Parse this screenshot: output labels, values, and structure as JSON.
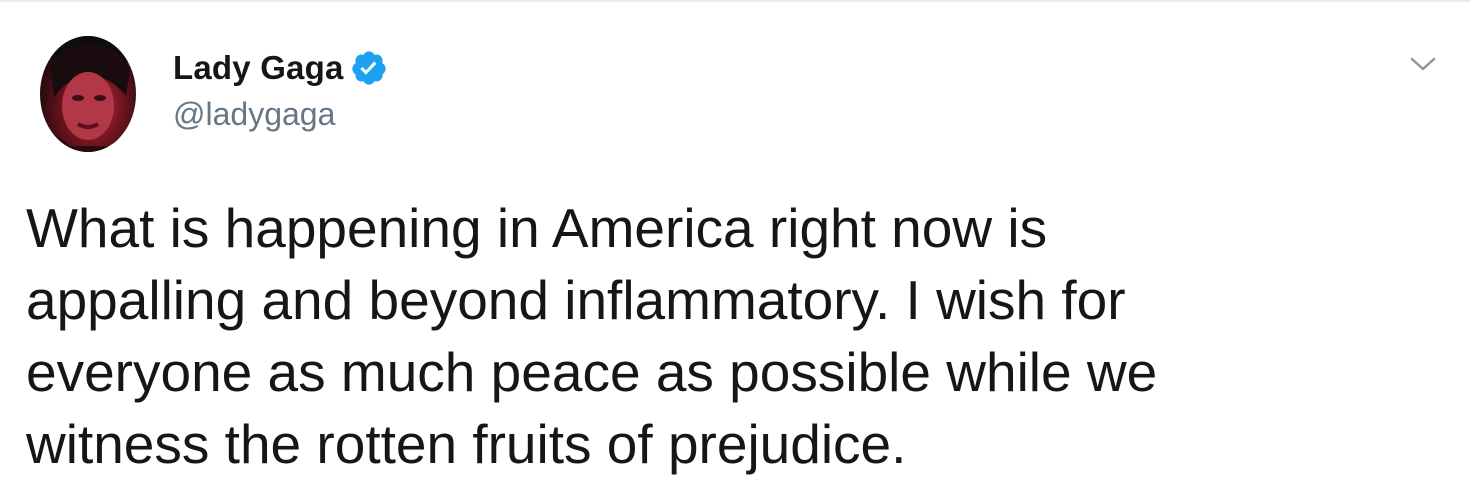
{
  "tweet": {
    "author": {
      "display_name": "Lady Gaga",
      "handle": "@ladygaga",
      "verified": true,
      "verified_icon": "verified-badge-icon",
      "avatar_icon": "profile-photo"
    },
    "menu_icon": "chevron-down-icon",
    "text_lines": [
      "What is happening in America right now is",
      "appalling and beyond inflammatory. I wish for",
      "everyone as much peace as possible while we",
      "witness the rotten fruits of prejudice."
    ],
    "colors": {
      "verified_blue": "#1da1f2",
      "handle_gray": "#657786",
      "text": "#14171a"
    }
  }
}
